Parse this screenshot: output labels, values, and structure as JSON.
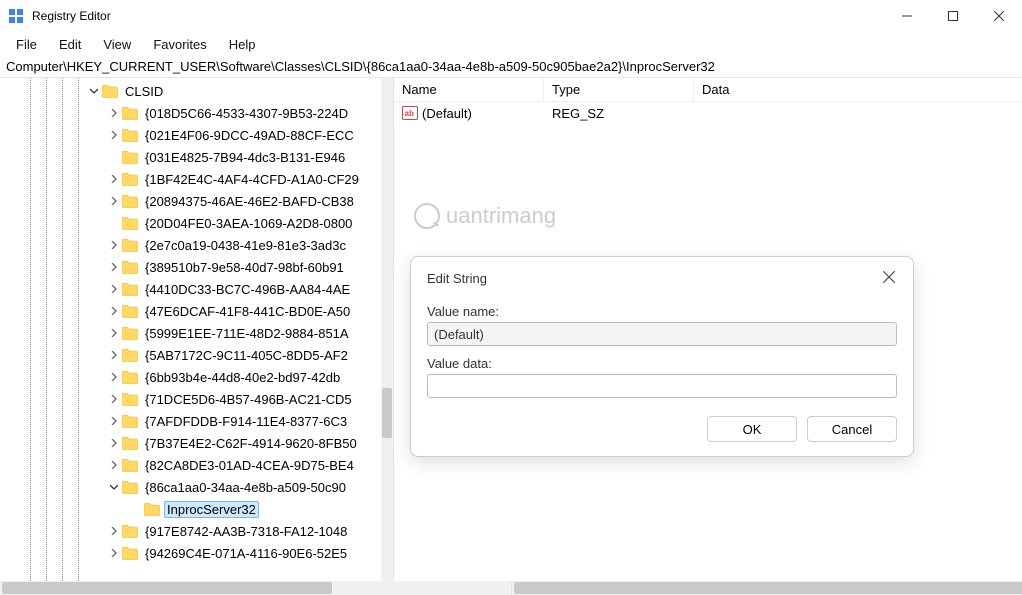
{
  "window": {
    "title": "Registry Editor"
  },
  "menu": {
    "file": "File",
    "edit": "Edit",
    "view": "View",
    "favorites": "Favorites",
    "help": "Help"
  },
  "address": "Computer\\HKEY_CURRENT_USER\\Software\\Classes\\CLSID\\{86ca1aa0-34aa-4e8b-a509-50c905bae2a2}\\InprocServer32",
  "tree": {
    "clsid_label": "CLSID",
    "items": [
      "{018D5C66-4533-4307-9B53-224D",
      "{021E4F06-9DCC-49AD-88CF-ECC",
      "{031E4825-7B94-4dc3-B131-E946",
      "{1BF42E4C-4AF4-4CFD-A1A0-CF29",
      "{20894375-46AE-46E2-BAFD-CB38",
      "{20D04FE0-3AEA-1069-A2D8-0800",
      "{2e7c0a19-0438-41e9-81e3-3ad3c",
      "{389510b7-9e58-40d7-98bf-60b91",
      "{4410DC33-BC7C-496B-AA84-4AE",
      "{47E6DCAF-41F8-441C-BD0E-A50",
      "{5999E1EE-711E-48D2-9884-851A",
      "{5AB7172C-9C11-405C-8DD5-AF2",
      "{6bb93b4e-44d8-40e2-bd97-42db",
      "{71DCE5D6-4B57-496B-AC21-CD5",
      "{7AFDFDDB-F914-11E4-8377-6C3",
      "{7B37E4E2-C62F-4914-9620-8FB50",
      "{82CA8DE3-01AD-4CEA-9D75-BE4",
      "{86ca1aa0-34aa-4e8b-a509-50c90",
      "{917E8742-AA3B-7318-FA12-1048",
      "{94269C4E-071A-4116-90E6-52E5"
    ],
    "inproc_label": "InprocServer32"
  },
  "list": {
    "headers": {
      "name": "Name",
      "type": "Type",
      "data": "Data"
    },
    "rows": [
      {
        "name": "(Default)",
        "type": "REG_SZ",
        "data": ""
      }
    ]
  },
  "dialog": {
    "title": "Edit String",
    "value_name_label": "Value name:",
    "value_name": "(Default)",
    "value_data_label": "Value data:",
    "value_data": "",
    "ok": "OK",
    "cancel": "Cancel"
  },
  "watermark": {
    "text": "uantrimang"
  }
}
